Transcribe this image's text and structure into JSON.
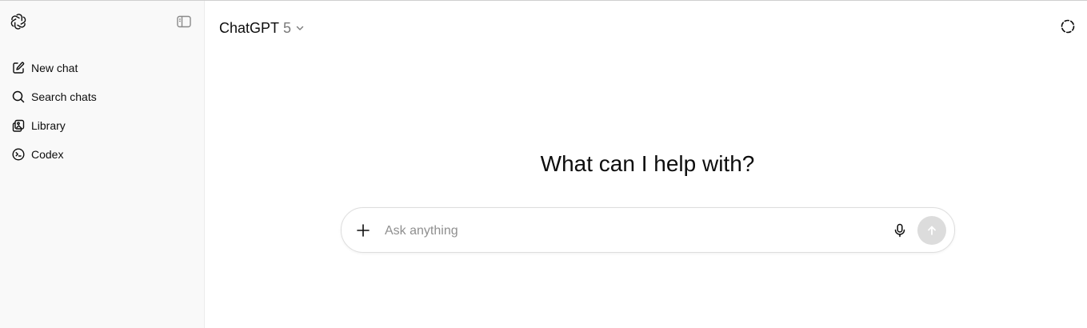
{
  "sidebar": {
    "logo_icon": "openai-logo-icon",
    "toggle_icon": "sidebar-toggle-icon",
    "items": [
      {
        "label": "New chat",
        "icon": "edit-icon"
      },
      {
        "label": "Search chats",
        "icon": "search-icon"
      },
      {
        "label": "Library",
        "icon": "library-icon"
      },
      {
        "label": "Codex",
        "icon": "codex-icon"
      }
    ]
  },
  "header": {
    "model_name": "ChatGPT",
    "model_version": "5",
    "temporary_chat_icon": "dashed-circle-icon"
  },
  "main": {
    "headline": "What can I help with?",
    "composer": {
      "placeholder": "Ask anything",
      "value": "",
      "plus_icon": "plus-icon",
      "mic_icon": "microphone-icon",
      "send_icon": "arrow-up-icon"
    }
  },
  "colors": {
    "sidebar_bg": "#f9f9f9",
    "send_button_bg": "#dcdcdc",
    "text": "#0d0d0d",
    "muted_text": "#7a7a7a"
  }
}
